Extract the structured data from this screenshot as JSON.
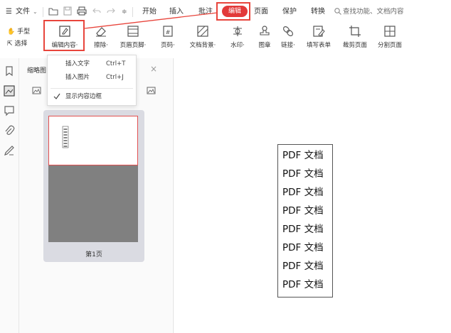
{
  "menubar": {
    "file_label": "文件",
    "tabs": [
      {
        "label": "开始"
      },
      {
        "label": "插入"
      },
      {
        "label": "批注"
      },
      {
        "label": "编辑",
        "active": true
      },
      {
        "label": "页面"
      },
      {
        "label": "保护"
      },
      {
        "label": "转换"
      }
    ],
    "search_text": "查找功能、文档内容",
    "accent_color": "#e23a3a"
  },
  "toolbar": {
    "hand_label": "手型",
    "select_label": "选择",
    "tools": [
      {
        "label": "编辑内容·",
        "icon": "edit-content-icon"
      },
      {
        "label": "擦除·",
        "icon": "eraser-icon"
      },
      {
        "label": "页眉页脚·",
        "icon": "header-footer-icon"
      },
      {
        "label": "页码·",
        "icon": "page-number-icon"
      },
      {
        "label": "文档背景·",
        "icon": "background-icon"
      },
      {
        "label": "水印·",
        "icon": "watermark-icon"
      },
      {
        "label": "图章",
        "icon": "stamp-icon"
      },
      {
        "label": "链接·",
        "icon": "link-icon"
      },
      {
        "label": "填写表单",
        "icon": "fill-form-icon"
      },
      {
        "label": "裁剪页面",
        "icon": "crop-page-icon"
      },
      {
        "label": "分割页面",
        "icon": "split-page-icon"
      }
    ]
  },
  "sidebar_panel": {
    "title": "缩略图",
    "page_label": "第1页"
  },
  "dropdown": {
    "items": [
      {
        "label": "插入文字",
        "shortcut": "Ctrl+T"
      },
      {
        "label": "插入图片",
        "shortcut": "Ctrl+J"
      }
    ],
    "toggle_label": "显示内容边框",
    "toggle_checked": true
  },
  "document": {
    "lines": [
      "PDF 文档",
      "PDF 文档",
      "PDF 文档",
      "PDF 文档",
      "PDF 文档",
      "PDF 文档",
      "PDF 文档",
      "PDF 文档"
    ]
  }
}
